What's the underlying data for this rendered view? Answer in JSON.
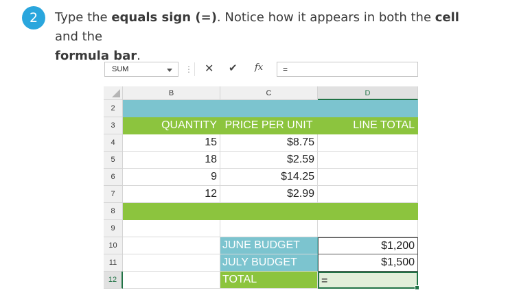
{
  "step": {
    "number": "2",
    "line1_pre": "Type the ",
    "line1_bold": "equals sign (=)",
    "line1_post": ". Notice how it appears in both the ",
    "line1_bold2": "cell",
    "line1_post2": " and the",
    "line2_bold": "formula bar",
    "line2_post": "."
  },
  "formula_bar": {
    "name_box": "SUM",
    "cancel_glyph": "✕",
    "enter_glyph": "✔",
    "fx_label": "fx",
    "content": "="
  },
  "columns": [
    "B",
    "C",
    "D"
  ],
  "rows": [
    "2",
    "3",
    "4",
    "5",
    "6",
    "7",
    "8",
    "9",
    "10",
    "11",
    "12"
  ],
  "table": {
    "header_quantity": "QUANTITY",
    "header_price": "PRICE PER UNIT",
    "header_total": "LINE TOTAL",
    "items": [
      {
        "quantity": "15",
        "price": "$8.75"
      },
      {
        "quantity": "18",
        "price": "$2.59"
      },
      {
        "quantity": "9",
        "price": "$14.25"
      },
      {
        "quantity": "12",
        "price": "$2.99"
      }
    ],
    "june_label": "JUNE BUDGET",
    "june_value": "$1,200",
    "july_label": "JULY BUDGET",
    "july_value": "$1,500",
    "total_label": "TOTAL",
    "active_cell_content": "="
  },
  "colors": {
    "badge": "#2aa6dd",
    "green_band": "#8cc43e",
    "teal_band": "#7cc4cf",
    "selection": "#217346"
  }
}
